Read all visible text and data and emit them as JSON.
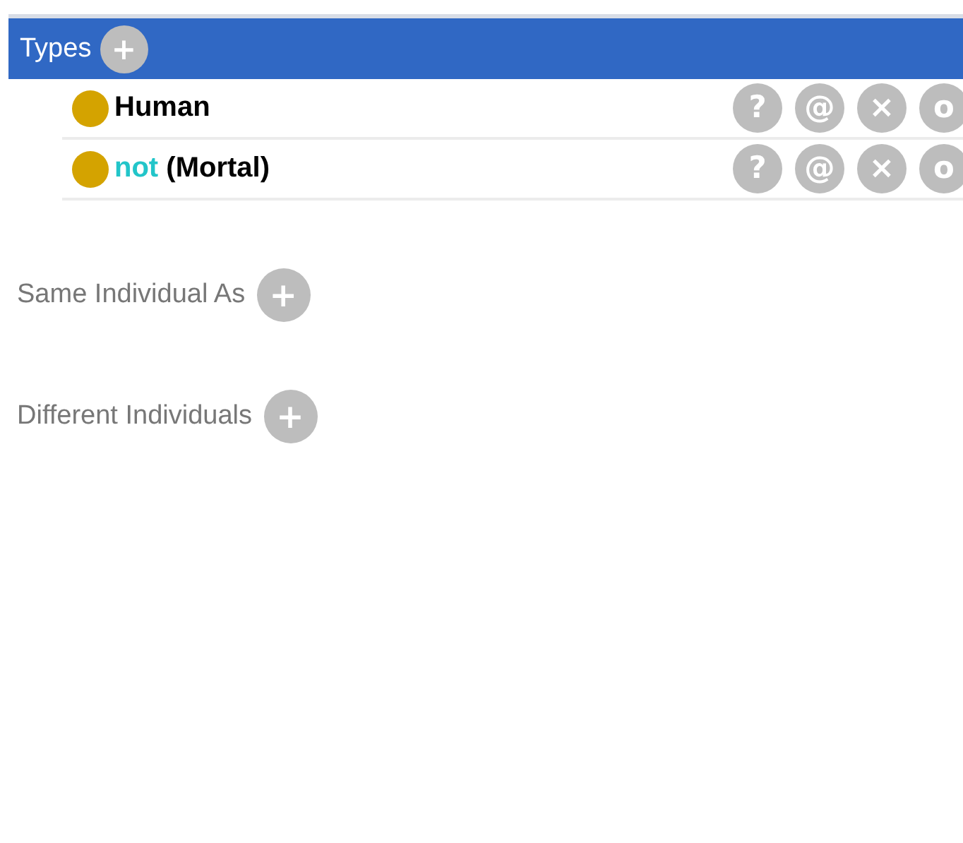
{
  "header": {
    "title": "Types",
    "add_button": "+"
  },
  "types": [
    {
      "parts": [
        {
          "kind": "text",
          "text": "Human"
        }
      ],
      "actions": [
        "?",
        "@",
        "×",
        "o"
      ]
    },
    {
      "parts": [
        {
          "kind": "keyword",
          "text": "not"
        },
        {
          "kind": "text",
          "text": "(Mortal)"
        }
      ],
      "actions": [
        "?",
        "@",
        "×",
        "o"
      ]
    }
  ],
  "sections": [
    {
      "title": "Same Individual As",
      "add_button": "+"
    },
    {
      "title": "Different Individuals",
      "add_button": "+"
    }
  ]
}
